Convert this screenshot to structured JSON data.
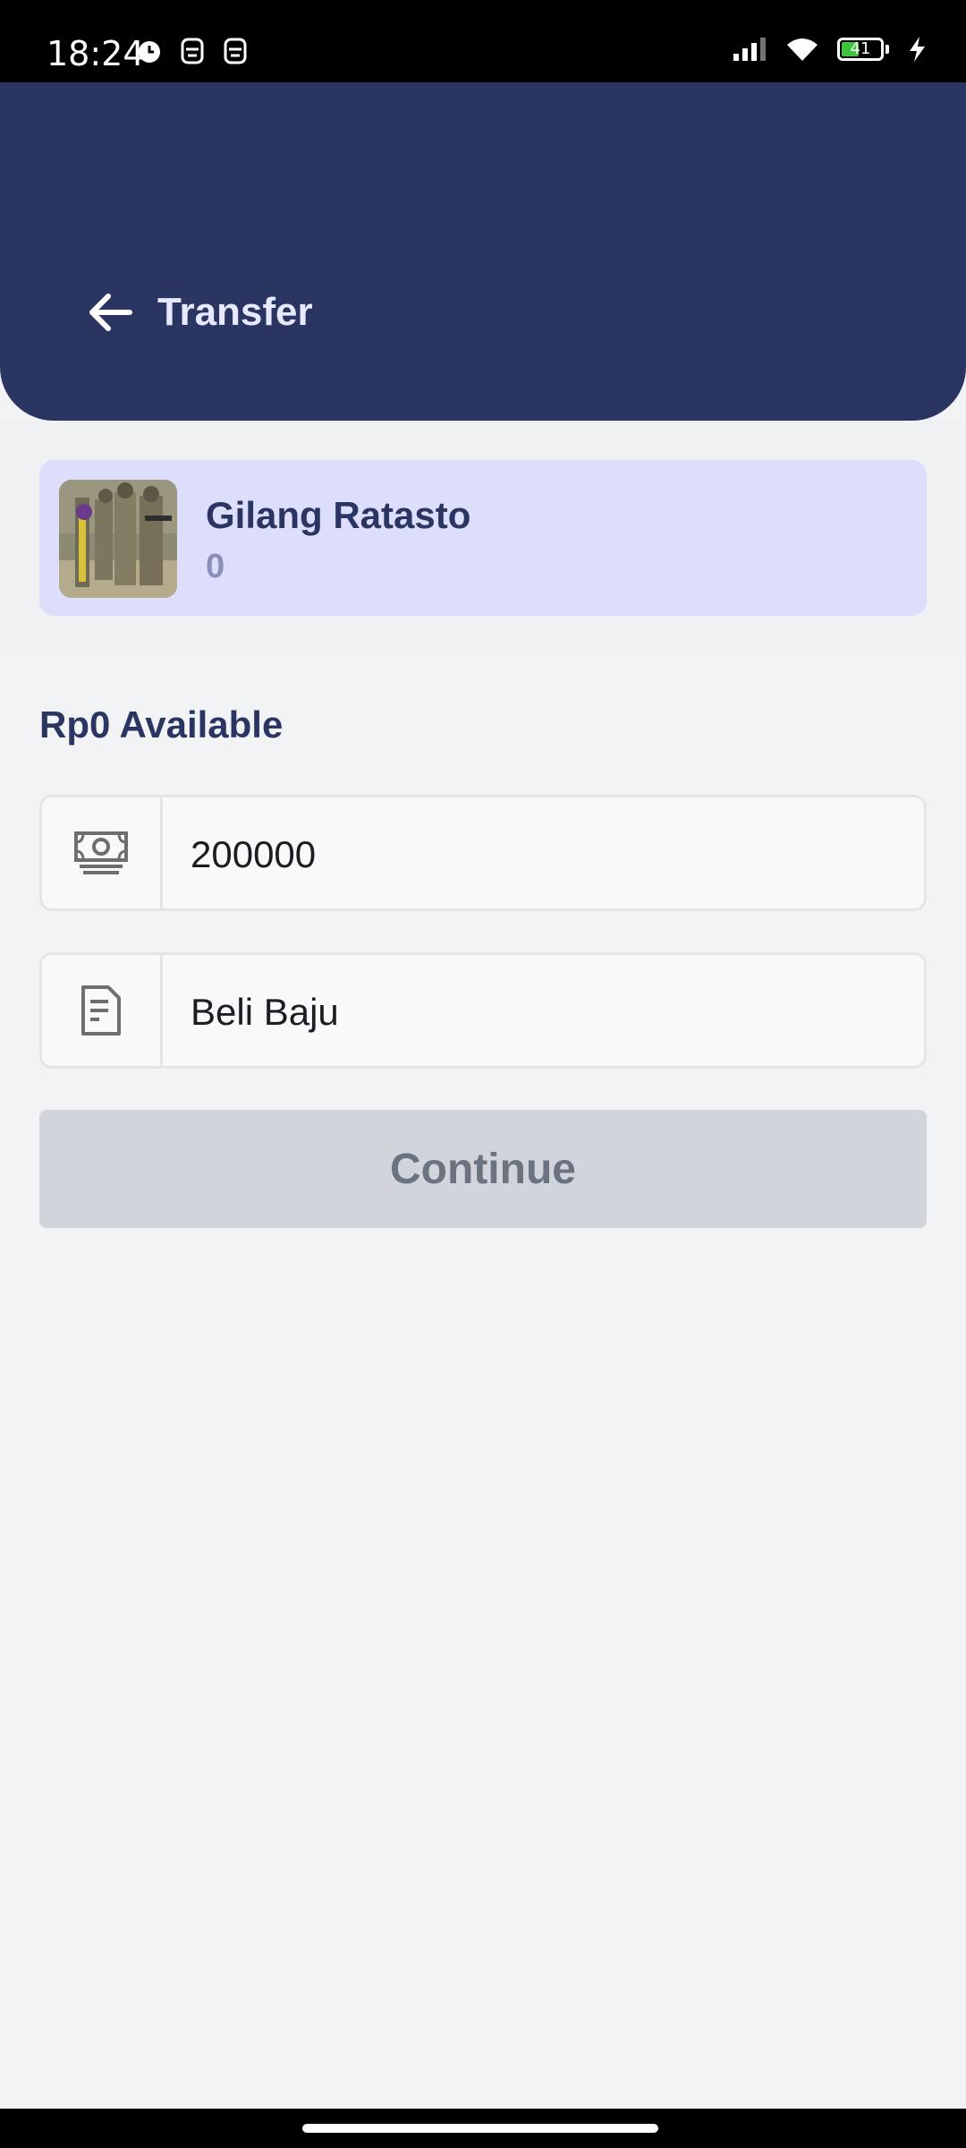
{
  "status_bar": {
    "time": "18:24",
    "battery_level": "41"
  },
  "header": {
    "title": "Transfer"
  },
  "recipient": {
    "name": "Gilang Ratasto",
    "account": "0"
  },
  "available": "Rp0 Available",
  "amount_field": {
    "value": "200000",
    "icon": "money-icon"
  },
  "note_field": {
    "value": "Beli Baju",
    "icon": "document-icon"
  },
  "continue_label": "Continue",
  "colors": {
    "header_bg": "#2b3562",
    "card_bg": "#dcdefb",
    "button_disabled": "#d2d4db"
  }
}
